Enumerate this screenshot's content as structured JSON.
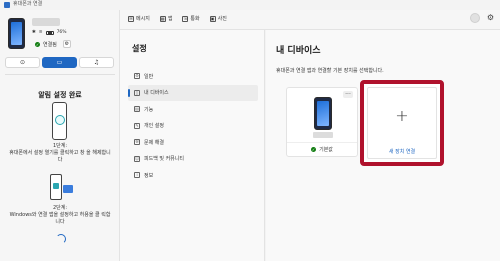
{
  "window": {
    "title": "휴대폰과 연결"
  },
  "sidebar": {
    "battery_text": "76%",
    "connection_status": "연결됨",
    "mode_buttons": [
      "⊙",
      "▭",
      "♫"
    ],
    "setup_title": "알림 설정 완료",
    "step1_label": "1단계:",
    "step1_desc": "휴대폰에서 설정 열기를 클릭하고 창 을 해제합니다",
    "step2_label": "2단계:",
    "step2_desc": "Windows와 연결 앱을 설정하고 허용을 클 릭합니다"
  },
  "topnav": {
    "items": [
      {
        "label": "메시지",
        "icon": "message-icon"
      },
      {
        "label": "앱",
        "icon": "apps-icon"
      },
      {
        "label": "통화",
        "icon": "phone-icon"
      },
      {
        "label": "사진",
        "icon": "photo-icon"
      }
    ]
  },
  "settings": {
    "title": "설정",
    "menu": [
      {
        "label": "일반",
        "icon": "gear-icon",
        "active": false
      },
      {
        "label": "내 디바이스",
        "icon": "device-icon",
        "active": true
      },
      {
        "label": "기능",
        "icon": "features-icon",
        "active": false
      },
      {
        "label": "개인 설정",
        "icon": "personalize-icon",
        "active": false
      },
      {
        "label": "문제 해결",
        "icon": "wrench-icon",
        "active": false
      },
      {
        "label": "피드백 및 커뮤니티",
        "icon": "feedback-icon",
        "active": false
      },
      {
        "label": "정보",
        "icon": "info-icon",
        "active": false
      }
    ]
  },
  "content": {
    "title": "내 디바이스",
    "subtitle": "휴대폰과 연결 앱과 연결할 기본 장치를 선택합니다.",
    "device_card": {
      "more": "...",
      "default_label": "기본값"
    },
    "add_card": {
      "plus": "+",
      "label": "새 장치 연결"
    }
  },
  "colors": {
    "accent": "#1f67c2",
    "highlight": "#b0122d",
    "success": "#107c10"
  }
}
